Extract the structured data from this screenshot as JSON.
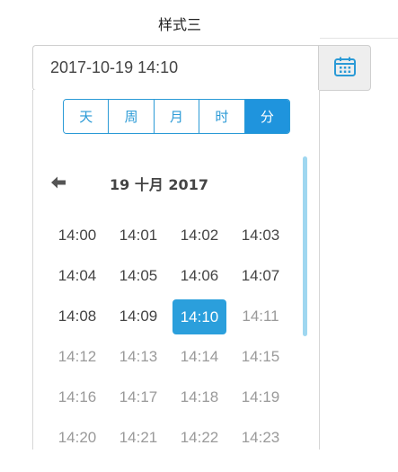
{
  "title": "样式三",
  "input": {
    "value": "2017-10-19 14:10"
  },
  "icons": {
    "calendar": "calendar-icon",
    "back": "arrow-left-icon"
  },
  "tabs": [
    {
      "label": "天",
      "active": false
    },
    {
      "label": "周",
      "active": false
    },
    {
      "label": "月",
      "active": false
    },
    {
      "label": "时",
      "active": false
    },
    {
      "label": "分",
      "active": true
    }
  ],
  "nav": {
    "period_label": "19 十月 2017"
  },
  "times": [
    {
      "label": "14:00",
      "state": "normal"
    },
    {
      "label": "14:01",
      "state": "normal"
    },
    {
      "label": "14:02",
      "state": "normal"
    },
    {
      "label": "14:03",
      "state": "normal"
    },
    {
      "label": "14:04",
      "state": "normal"
    },
    {
      "label": "14:05",
      "state": "normal"
    },
    {
      "label": "14:06",
      "state": "normal"
    },
    {
      "label": "14:07",
      "state": "normal"
    },
    {
      "label": "14:08",
      "state": "normal"
    },
    {
      "label": "14:09",
      "state": "normal"
    },
    {
      "label": "14:10",
      "state": "selected"
    },
    {
      "label": "14:11",
      "state": "muted"
    },
    {
      "label": "14:12",
      "state": "muted"
    },
    {
      "label": "14:13",
      "state": "muted"
    },
    {
      "label": "14:14",
      "state": "muted"
    },
    {
      "label": "14:15",
      "state": "muted"
    },
    {
      "label": "14:16",
      "state": "muted"
    },
    {
      "label": "14:17",
      "state": "muted"
    },
    {
      "label": "14:18",
      "state": "muted"
    },
    {
      "label": "14:19",
      "state": "muted"
    },
    {
      "label": "14:20",
      "state": "muted"
    },
    {
      "label": "14:21",
      "state": "muted"
    },
    {
      "label": "14:22",
      "state": "muted"
    },
    {
      "label": "14:23",
      "state": "muted"
    }
  ],
  "colors": {
    "accent": "#1f94dd",
    "selected": "#2b9fdc",
    "scrollbar": "#9fd7f0",
    "muted_text": "#9a9a9a"
  }
}
